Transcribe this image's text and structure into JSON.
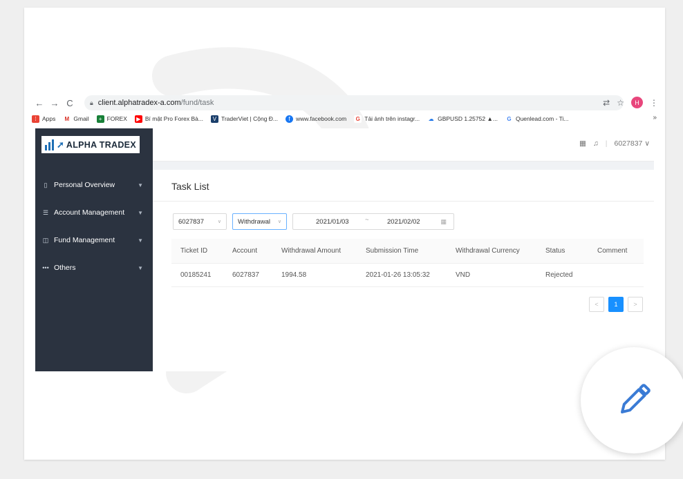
{
  "browser": {
    "url_host": "client.alphatradex-a.com",
    "url_path": "/fund/task",
    "profile_initial": "H",
    "bookmarks": [
      {
        "label": "Apps",
        "icon": "apps-grid-icon",
        "color": "#ea4335"
      },
      {
        "label": "Gmail",
        "icon": "gmail-icon",
        "color": "#d93025"
      },
      {
        "label": "FOREX",
        "icon": "sheets-icon",
        "color": "#188038"
      },
      {
        "label": "Bí mật Pro Forex Bà...",
        "icon": "youtube-icon",
        "color": "#ff0000"
      },
      {
        "label": "TraderViet | Cộng Đ...",
        "icon": "traderviet-icon",
        "color": "#1a3e6b"
      },
      {
        "label": "www.facebook.com",
        "icon": "facebook-icon",
        "color": "#1877f2"
      },
      {
        "label": "Tải ảnh trên instagr...",
        "icon": "g-icon",
        "color": "#ea4335"
      },
      {
        "label": "GBPUSD 1.25752 ▲...",
        "icon": "cloud-icon",
        "color": "#1a73e8"
      },
      {
        "label": "Quenlead.com - Ti...",
        "icon": "google-icon",
        "color": "#4285f4"
      }
    ],
    "more": "»"
  },
  "app": {
    "logo_text": "ALPHA TRADEX",
    "account_id": "6027837",
    "menu": [
      {
        "label": "Personal Overview",
        "icon": "document-icon"
      },
      {
        "label": "Account Management",
        "icon": "list-icon"
      },
      {
        "label": "Fund Management",
        "icon": "database-icon"
      },
      {
        "label": "Others",
        "icon": "ellipsis-icon"
      }
    ],
    "page_title": "Task List",
    "filters": {
      "account": "6027837",
      "type": "Withdrawal",
      "date_from": "2021/01/03",
      "date_sep": "~",
      "date_to": "2021/02/02"
    },
    "table": {
      "columns": [
        "Ticket ID",
        "Account",
        "Withdrawal Amount",
        "Submission Time",
        "Withdrawal Currency",
        "Status",
        "Comment"
      ],
      "rows": [
        [
          "00185241",
          "6027837",
          "1994.58",
          "2021-01-26 13:05:32",
          "VND",
          "Rejected",
          ""
        ]
      ]
    },
    "pagination": {
      "current": "1"
    }
  },
  "colors": {
    "sidebar": "#2b3340",
    "accent": "#1890ff",
    "fab_icon": "#3a7bd5"
  }
}
